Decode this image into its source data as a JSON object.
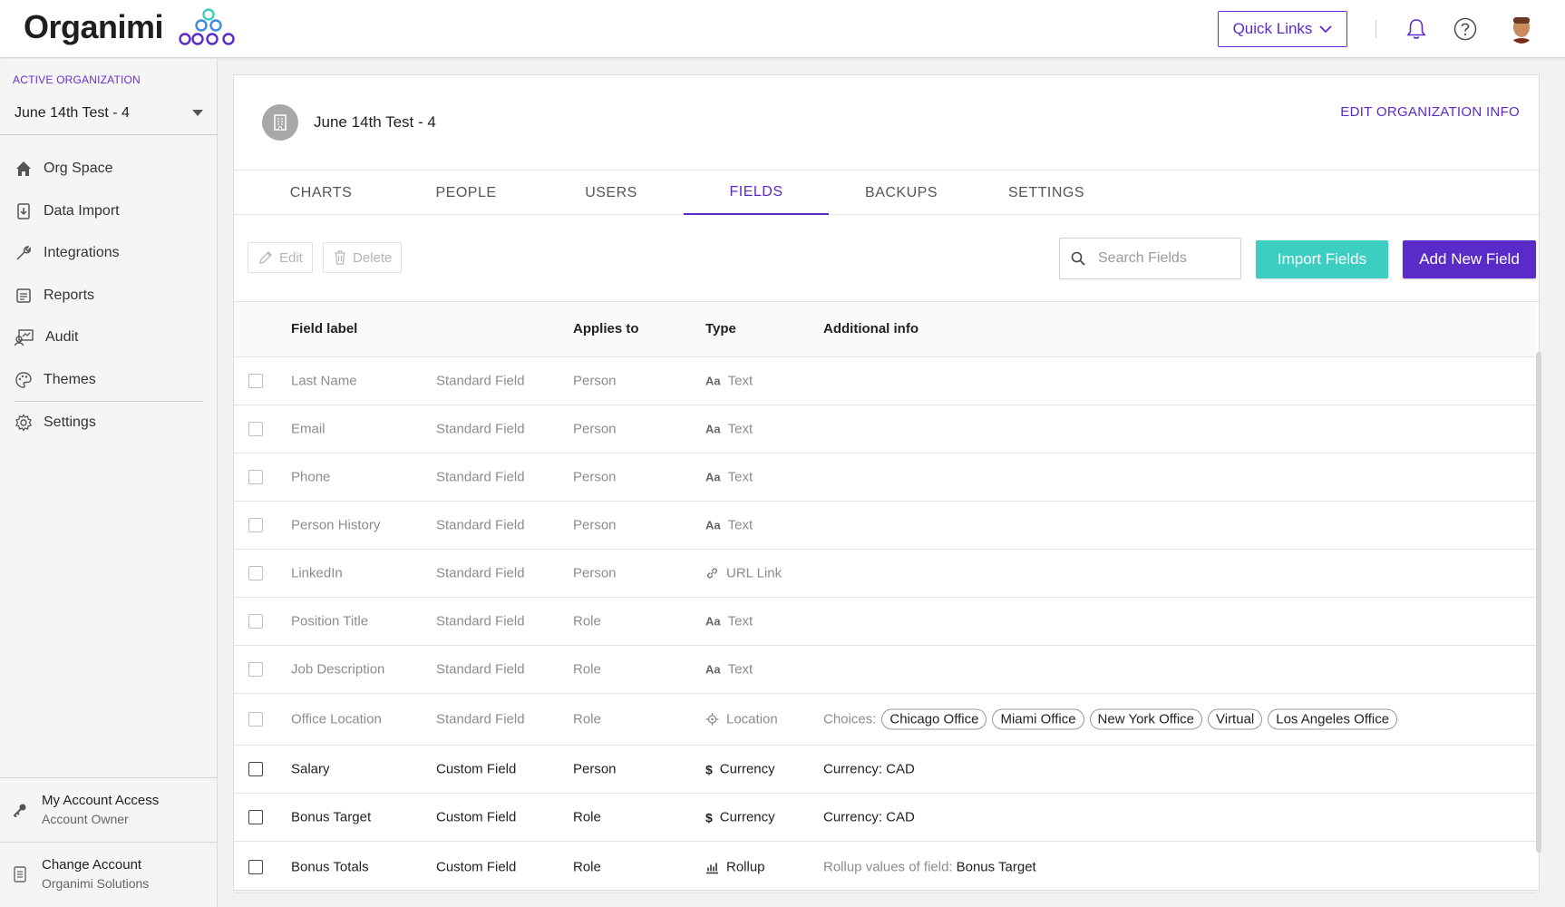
{
  "app": {
    "logo_text": "Organimi"
  },
  "topbar": {
    "quick_links": "Quick Links"
  },
  "sidebar": {
    "active_org_label": "ACTIVE ORGANIZATION",
    "active_org_value": "June 14th Test - 4",
    "items": [
      {
        "label": "Org Space",
        "icon": "home-icon"
      },
      {
        "label": "Data Import",
        "icon": "import-icon"
      },
      {
        "label": "Integrations",
        "icon": "wrench-icon"
      },
      {
        "label": "Reports",
        "icon": "reports-icon"
      },
      {
        "label": "Audit",
        "icon": "audit-icon"
      },
      {
        "label": "Themes",
        "icon": "palette-icon"
      },
      {
        "label": "Settings",
        "icon": "gear-icon"
      }
    ],
    "account_access": {
      "title": "My Account Access",
      "subtitle": "Account Owner"
    },
    "change_account": {
      "title": "Change Account",
      "subtitle": "Organimi Solutions"
    }
  },
  "org": {
    "name": "June 14th Test - 4",
    "edit_link": "EDIT ORGANIZATION INFO"
  },
  "tabs": [
    {
      "label": "CHARTS",
      "active": false
    },
    {
      "label": "PEOPLE",
      "active": false
    },
    {
      "label": "USERS",
      "active": false
    },
    {
      "label": "FIELDS",
      "active": true
    },
    {
      "label": "BACKUPS",
      "active": false
    },
    {
      "label": "SETTINGS",
      "active": false
    }
  ],
  "toolbar": {
    "edit_label": "Edit",
    "delete_label": "Delete",
    "search_placeholder": "Search Fields",
    "import_label": "Import Fields",
    "add_label": "Add New Field"
  },
  "table": {
    "headers": {
      "label": "Field label",
      "applies": "Applies to",
      "type": "Type",
      "info": "Additional info"
    },
    "rows": [
      {
        "label": "Last Name",
        "kind": "Standard Field",
        "applies": "Person",
        "type": "Text",
        "type_icon": "text-icon",
        "info": ""
      },
      {
        "label": "Email",
        "kind": "Standard Field",
        "applies": "Person",
        "type": "Text",
        "type_icon": "text-icon",
        "info": ""
      },
      {
        "label": "Phone",
        "kind": "Standard Field",
        "applies": "Person",
        "type": "Text",
        "type_icon": "text-icon",
        "info": ""
      },
      {
        "label": "Person History",
        "kind": "Standard Field",
        "applies": "Person",
        "type": "Text",
        "type_icon": "text-icon",
        "info": ""
      },
      {
        "label": "LinkedIn",
        "kind": "Standard Field",
        "applies": "Person",
        "type": "URL Link",
        "type_icon": "link-icon",
        "info": ""
      },
      {
        "label": "Position Title",
        "kind": "Standard Field",
        "applies": "Role",
        "type": "Text",
        "type_icon": "text-icon",
        "info": ""
      },
      {
        "label": "Job Description",
        "kind": "Standard Field",
        "applies": "Role",
        "type": "Text",
        "type_icon": "text-icon",
        "info": ""
      },
      {
        "label": "Office Location",
        "kind": "Standard Field",
        "applies": "Role",
        "type": "Location",
        "type_icon": "location-icon",
        "info_prefix": "Choices:",
        "choices": [
          "Chicago Office",
          "Miami Office",
          "New York Office",
          "Virtual",
          "Los Angeles Office"
        ]
      },
      {
        "label": "Salary",
        "kind": "Custom Field",
        "applies": "Person",
        "type": "Currency",
        "type_icon": "dollar-icon",
        "info": "Currency: CAD"
      },
      {
        "label": "Bonus Target",
        "kind": "Custom Field",
        "applies": "Role",
        "type": "Currency",
        "type_icon": "dollar-icon",
        "info": "Currency: CAD"
      },
      {
        "label": "Bonus Totals",
        "kind": "Custom Field",
        "applies": "Role",
        "type": "Rollup",
        "type_icon": "rollup-icon",
        "info_prefix": "Rollup values of field:",
        "info_value": "Bonus Target"
      }
    ]
  },
  "colors": {
    "accent": "#5a2bc9",
    "teal": "#3ccfc1"
  }
}
